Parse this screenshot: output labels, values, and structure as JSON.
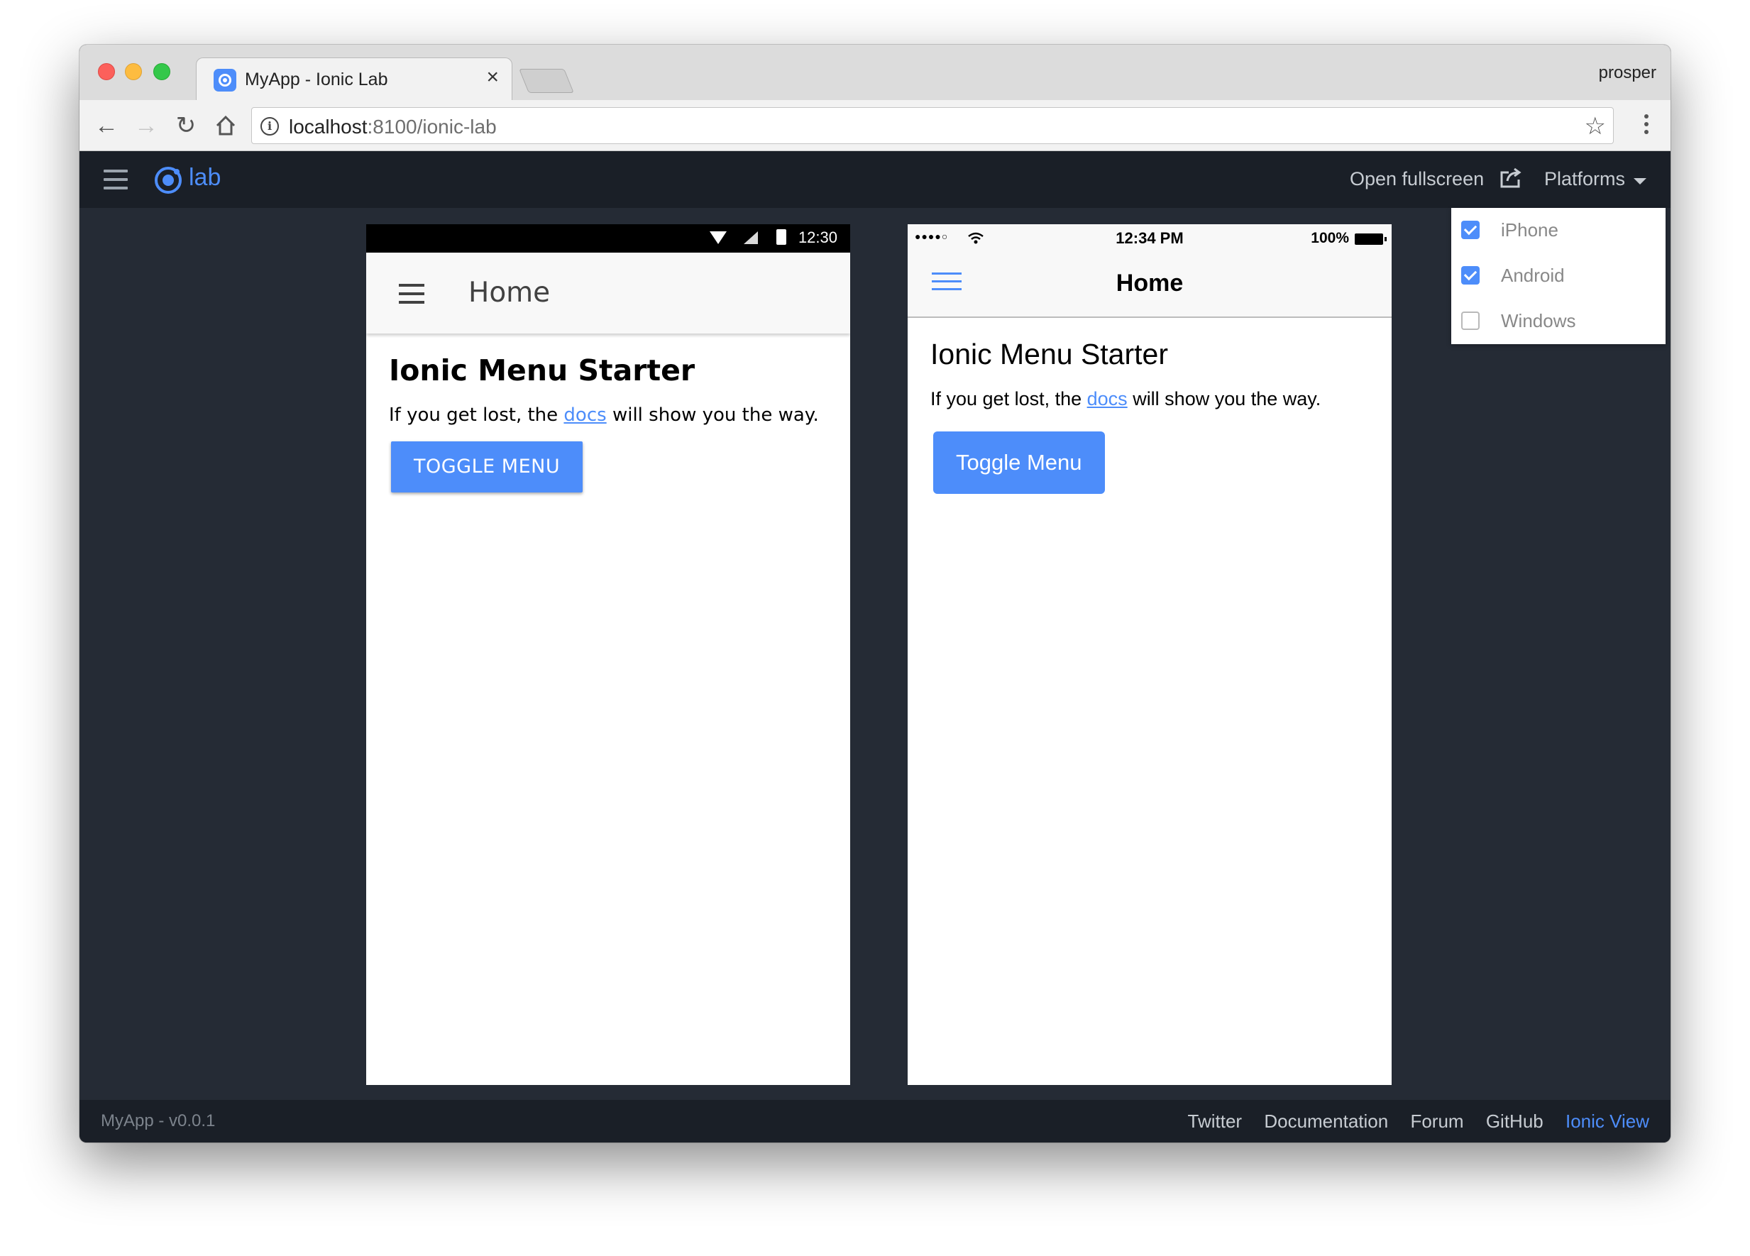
{
  "browser": {
    "tab_title": "MyApp - Ionic Lab",
    "tab_close": "×",
    "profile_name": "prosper",
    "url_host": "localhost",
    "url_rest": ":8100/ionic-lab"
  },
  "lab": {
    "logo_text": "lab",
    "open_fullscreen": "Open fullscreen",
    "platforms": "Platforms",
    "platform_options": [
      {
        "label": "iPhone",
        "checked": true
      },
      {
        "label": "Android",
        "checked": true
      },
      {
        "label": "Windows",
        "checked": false
      }
    ]
  },
  "android": {
    "time": "12:30",
    "title": "Home",
    "heading": "Ionic Menu Starter",
    "text_before": "If you get lost, the ",
    "link": "docs",
    "text_after": " will show you the way.",
    "button": "TOGGLE MENU"
  },
  "ios": {
    "signal": "●●●●○",
    "time": "12:34 PM",
    "battery": "100%",
    "title": "Home",
    "heading": "Ionic Menu Starter",
    "text_before": "If you get lost, the ",
    "link": "docs",
    "text_after": " will show you the way.",
    "button": "Toggle Menu"
  },
  "footer": {
    "version": "MyApp - v0.0.1",
    "links": [
      "Twitter",
      "Documentation",
      "Forum",
      "GitHub",
      "Ionic View"
    ]
  },
  "colors": {
    "accent": "#4d8dfa",
    "lab_bg": "#252b35",
    "lab_header": "#1a1f27"
  },
  "icons": [
    "back-arrow-icon",
    "forward-arrow-icon",
    "reload-icon",
    "home-icon",
    "info-icon",
    "star-icon",
    "kebab-menu-icon",
    "hamburger-icon",
    "ionic-logo-icon",
    "share-icon",
    "caret-down-icon",
    "wifi-icon",
    "signal-icon",
    "battery-icon"
  ]
}
